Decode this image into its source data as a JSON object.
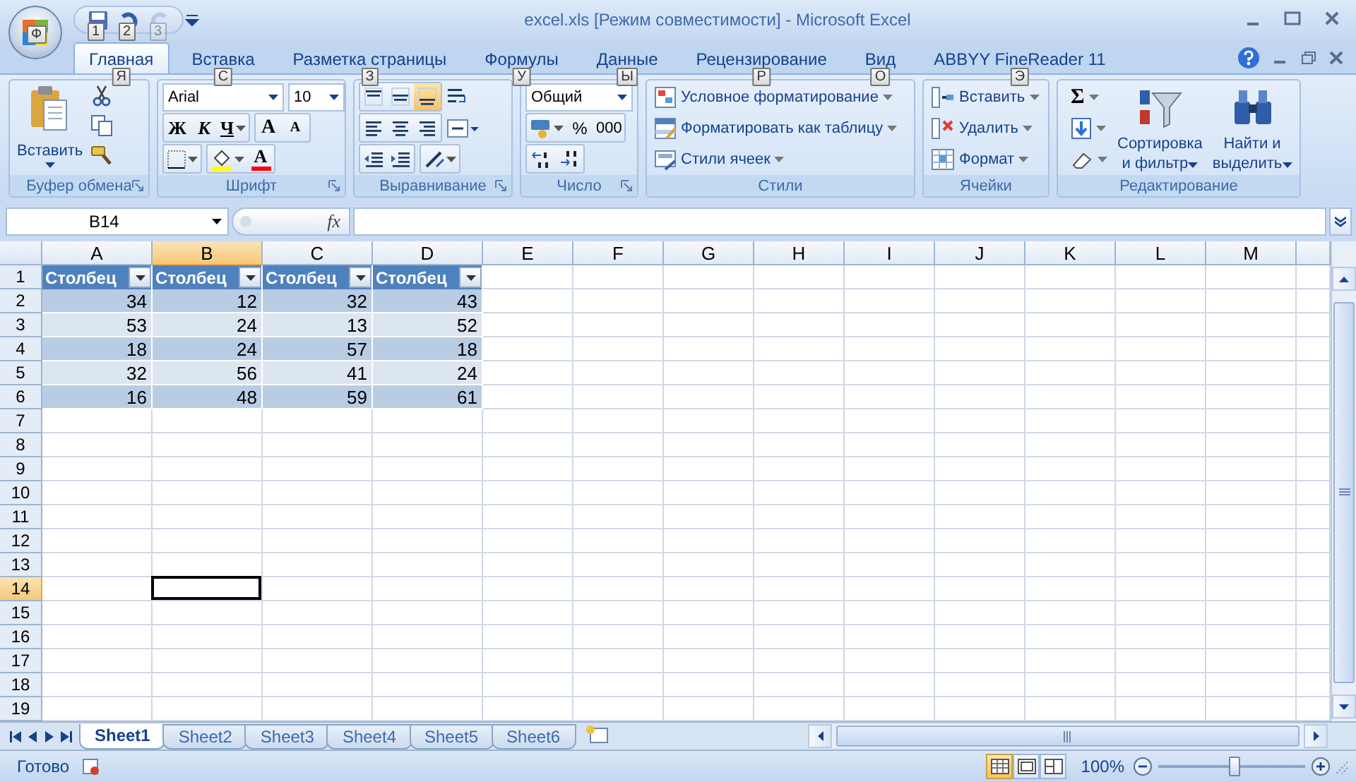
{
  "office_button": {
    "keytip": "Ф"
  },
  "quick_access": [
    {
      "kind": "save",
      "keytip": "1",
      "disabled": false
    },
    {
      "kind": "undo",
      "keytip": "2",
      "disabled": false
    },
    {
      "kind": "redo",
      "keytip": "3",
      "disabled": true
    }
  ],
  "window": {
    "title": "excel.xls  [Режим совместимости] - Microsoft Excel"
  },
  "tabs": [
    {
      "label": "Главная",
      "selected": true,
      "keytip": "Я"
    },
    {
      "label": "Вставка",
      "selected": false,
      "keytip": "С"
    },
    {
      "label": "Разметка страницы",
      "selected": false,
      "keytip": "З"
    },
    {
      "label": "Формулы",
      "selected": false,
      "keytip": "У"
    },
    {
      "label": "Данные",
      "selected": false,
      "keytip": "Ы"
    },
    {
      "label": "Рецензирование",
      "selected": false,
      "keytip": "Р"
    },
    {
      "label": "Вид",
      "selected": false,
      "keytip": "О"
    },
    {
      "label": "ABBYY FineReader 11",
      "selected": false,
      "keytip": "Э"
    }
  ],
  "ribbon": {
    "clipboard": {
      "label": "Буфер обмена",
      "paste": "Вставить"
    },
    "font": {
      "label": "Шрифт",
      "font": "Arial",
      "size": "10",
      "bold": "Ж",
      "italic": "К",
      "underline": "Ч",
      "grow": "A",
      "shrink": "A",
      "font_color_letter": "A"
    },
    "alignment": {
      "label": "Выравнивание",
      "vertical_align": [
        {
          "kind": "top",
          "selected": false
        },
        {
          "kind": "middle",
          "selected": false
        },
        {
          "kind": "bottom",
          "selected": true
        }
      ]
    },
    "number": {
      "label": "Число",
      "format": "Общий",
      "percent": "%",
      "thousands": "000"
    },
    "styles": {
      "label": "Стили",
      "items": [
        {
          "kind": "conditional",
          "label": "Условное форматирование"
        },
        {
          "kind": "table",
          "label": "Форматировать как таблицу"
        },
        {
          "kind": "cell_styles",
          "label": "Стили ячеек"
        }
      ]
    },
    "cells": {
      "label": "Ячейки",
      "items": [
        {
          "kind": "insert",
          "label": "Вставить"
        },
        {
          "kind": "delete",
          "label": "Удалить"
        },
        {
          "kind": "format",
          "label": "Формат"
        }
      ]
    },
    "editing": {
      "label": "Редактирование",
      "sum": "Σ",
      "sort": "Сортировка",
      "sort_line2": "и фильтр",
      "find": "Найти и",
      "find_line2": "выделить"
    }
  },
  "formula_bar": {
    "name_box": "B14",
    "fx": "fx"
  },
  "grid": {
    "columns": [
      {
        "label": "A",
        "selected": false
      },
      {
        "label": "B",
        "selected": true
      },
      {
        "label": "C",
        "selected": false
      },
      {
        "label": "D",
        "selected": false
      },
      {
        "label": "E",
        "selected": false
      },
      {
        "label": "F",
        "selected": false
      },
      {
        "label": "G",
        "selected": false
      },
      {
        "label": "H",
        "selected": false
      },
      {
        "label": "I",
        "selected": false
      },
      {
        "label": "J",
        "selected": false
      },
      {
        "label": "K",
        "selected": false
      },
      {
        "label": "L",
        "selected": false
      },
      {
        "label": "M",
        "selected": false
      }
    ],
    "rows": [
      {
        "label": "1",
        "selected": false
      },
      {
        "label": "2",
        "selected": false
      },
      {
        "label": "3",
        "selected": false
      },
      {
        "label": "4",
        "selected": false
      },
      {
        "label": "5",
        "selected": false
      },
      {
        "label": "6",
        "selected": false
      },
      {
        "label": "7",
        "selected": false
      },
      {
        "label": "8",
        "selected": false
      },
      {
        "label": "9",
        "selected": false
      },
      {
        "label": "10",
        "selected": false
      },
      {
        "label": "11",
        "selected": false
      },
      {
        "label": "12",
        "selected": false
      },
      {
        "label": "13",
        "selected": false
      },
      {
        "label": "14",
        "selected": true
      },
      {
        "label": "15",
        "selected": false
      },
      {
        "label": "16",
        "selected": false
      },
      {
        "label": "17",
        "selected": false
      },
      {
        "label": "18",
        "selected": false
      },
      {
        "label": "19",
        "selected": false
      }
    ]
  },
  "table": {
    "headers": [
      "Столбец",
      "Столбец",
      "Столбец",
      "Столбец"
    ],
    "rows": [
      [
        "34",
        "12",
        "32",
        "43"
      ],
      [
        "53",
        "24",
        "13",
        "52"
      ],
      [
        "18",
        "24",
        "57",
        "18"
      ],
      [
        "32",
        "56",
        "41",
        "24"
      ],
      [
        "16",
        "48",
        "59",
        "61"
      ]
    ]
  },
  "sheets": [
    {
      "label": "Sheet1",
      "selected": true
    },
    {
      "label": "Sheet2",
      "selected": false
    },
    {
      "label": "Sheet3",
      "selected": false
    },
    {
      "label": "Sheet4",
      "selected": false
    },
    {
      "label": "Sheet5",
      "selected": false
    },
    {
      "label": "Sheet6",
      "selected": false
    }
  ],
  "status_bar": {
    "text": "Готово",
    "views": [
      {
        "kind": "normal",
        "selected": true
      },
      {
        "kind": "page_layout",
        "selected": false
      },
      {
        "kind": "page_break",
        "selected": false
      }
    ],
    "zoom": "100%",
    "zoom_slider": {
      "level": 0.52
    }
  }
}
